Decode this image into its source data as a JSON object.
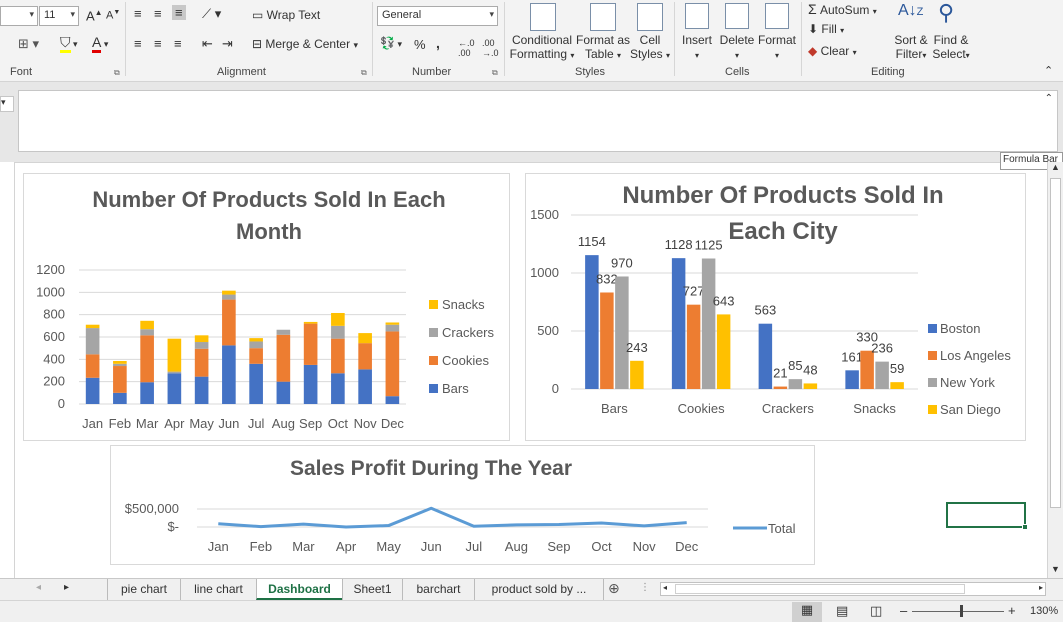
{
  "ribbon": {
    "font_size": "11",
    "wrap_text": "Wrap Text",
    "merge_center": "Merge & Center",
    "number_format": "General",
    "percent": "%",
    "comma": ",",
    "cond_fmt_1": "Conditional",
    "cond_fmt_2": "Formatting",
    "format_table_1": "Format as",
    "format_table_2": "Table",
    "cell_styles_1": "Cell",
    "cell_styles_2": "Styles",
    "insert": "Insert",
    "delete": "Delete",
    "format": "Format",
    "autosum": "AutoSum",
    "fill": "Fill",
    "clear": "Clear",
    "sort_filter_1": "Sort &",
    "sort_filter_2": "Filter",
    "find_select_1": "Find &",
    "find_select_2": "Select",
    "groups": {
      "font": "Font",
      "alignment": "Alignment",
      "number": "Number",
      "styles": "Styles",
      "cells": "Cells",
      "editing": "Editing"
    }
  },
  "formula_bar_tooltip": "Formula Bar",
  "sheet_tabs": [
    "pie chart",
    "line chart",
    "Dashboard",
    "Sheet1",
    "barchart",
    "product sold by ..."
  ],
  "active_tab": "Dashboard",
  "zoom": "130%",
  "colors": {
    "bars": "#4472C4",
    "cookies": "#ED7D31",
    "crackers": "#A5A5A5",
    "snacks": "#FFC000",
    "line": "#5B9BD5",
    "accent": "#1E7145"
  },
  "chart_data": [
    {
      "type": "bar",
      "stacked": true,
      "title": "Number Of Products Sold In Each Month",
      "categories": [
        "Jan",
        "Feb",
        "Mar",
        "Apr",
        "May",
        "Jun",
        "Jul",
        "Aug",
        "Sep",
        "Oct",
        "Nov",
        "Dec"
      ],
      "series": [
        {
          "name": "Bars",
          "values": [
            235,
            100,
            195,
            275,
            245,
            525,
            360,
            200,
            350,
            275,
            310,
            70
          ]
        },
        {
          "name": "Cookies",
          "values": [
            210,
            240,
            420,
            0,
            250,
            410,
            140,
            420,
            370,
            310,
            235,
            580
          ]
        },
        {
          "name": "Crackers",
          "values": [
            235,
            20,
            55,
            15,
            60,
            45,
            60,
            45,
            0,
            115,
            0,
            60
          ]
        },
        {
          "name": "Snacks",
          "values": [
            30,
            25,
            75,
            295,
            60,
            35,
            30,
            0,
            15,
            115,
            90,
            20
          ]
        }
      ],
      "ylim": [
        0,
        1200
      ],
      "yticks": [
        0,
        200,
        400,
        600,
        800,
        1000,
        1200
      ],
      "legend": "right"
    },
    {
      "type": "bar",
      "title": "Number Of Products Sold In Each City",
      "categories": [
        "Bars",
        "Cookies",
        "Crackers",
        "Snacks"
      ],
      "series": [
        {
          "name": "Boston",
          "values": [
            1154,
            1128,
            563,
            161
          ]
        },
        {
          "name": "Los Angeles",
          "values": [
            832,
            727,
            21,
            330
          ]
        },
        {
          "name": "New York",
          "values": [
            970,
            1125,
            85,
            236
          ]
        },
        {
          "name": "San Diego",
          "values": [
            243,
            643,
            48,
            59
          ]
        }
      ],
      "ylim": [
        0,
        1500
      ],
      "yticks": [
        0,
        500,
        1000,
        1500
      ],
      "legend": "right",
      "data_labels": true
    },
    {
      "type": "line",
      "title": "Sales Profit During The Year",
      "categories": [
        "Jan",
        "Feb",
        "Mar",
        "Apr",
        "May",
        "Jun",
        "Jul",
        "Aug",
        "Sep",
        "Oct",
        "Nov",
        "Dec"
      ],
      "series": [
        {
          "name": "Total",
          "values": [
            90000,
            10000,
            80000,
            0,
            40000,
            520000,
            20000,
            60000,
            70000,
            110000,
            30000,
            120000
          ]
        }
      ],
      "ytick_labels": [
        "$-",
        "$500,000"
      ],
      "ylim": [
        0,
        600000
      ],
      "legend": "right"
    }
  ]
}
